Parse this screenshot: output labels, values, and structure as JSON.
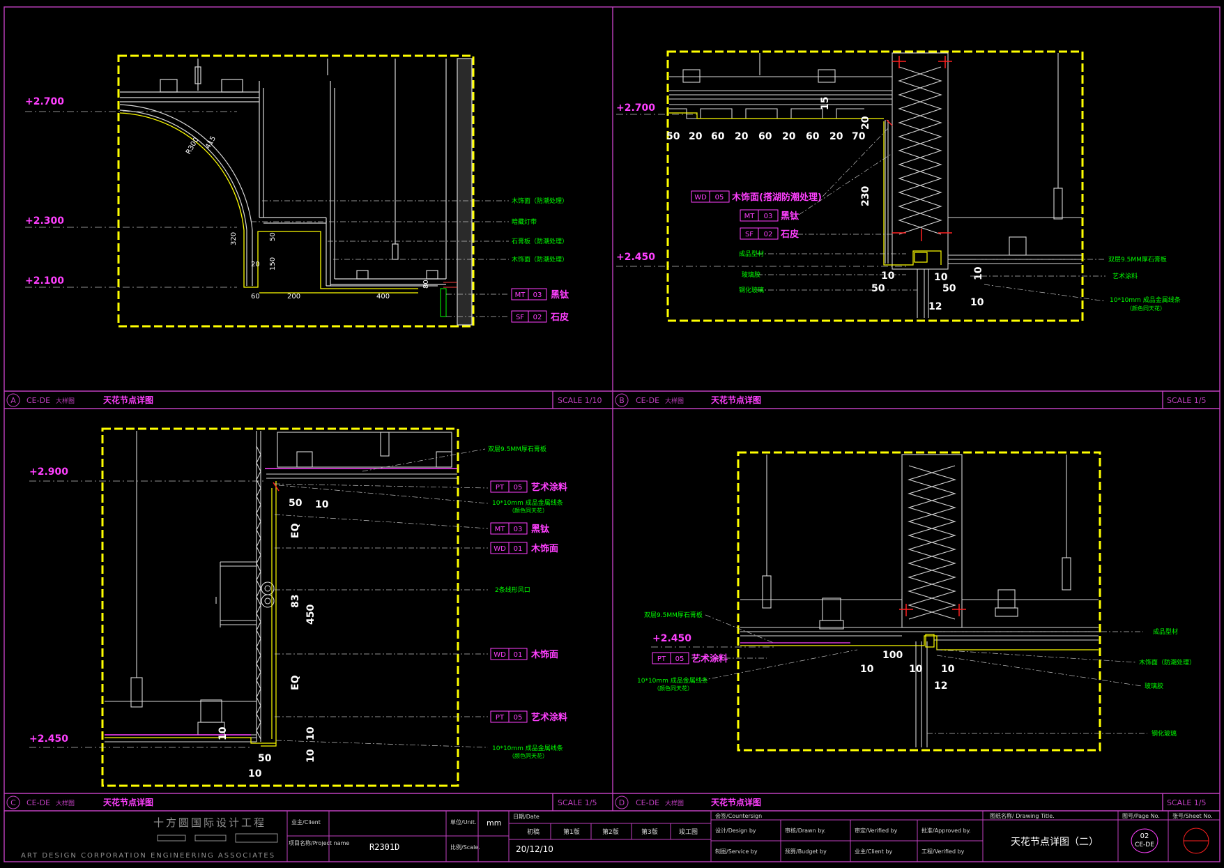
{
  "colors": {
    "bg": "#000000",
    "frame": "#c040c0",
    "detail": "#ffff00",
    "level": "#ff40ff",
    "note": "#00ff00",
    "line": "#d8d8d8",
    "dim": "#ffffff",
    "tag": "#ff40ff",
    "accent": "#ff2020"
  },
  "panels": {
    "a": {
      "letter": "A",
      "code": "CE-DE",
      "kind": "大样图",
      "title": "天花节点详图",
      "scale": "SCALE 1/10",
      "levels": [
        "+2.700",
        "+2.300",
        "+2.100"
      ],
      "dims": [
        "R300",
        "415",
        "320",
        "20",
        "150",
        "50",
        "60",
        "200",
        "400",
        "80"
      ],
      "notes": [
        "木饰面（防潮处理）",
        "暗藏灯带",
        "石膏板（防潮处理）",
        "木饰面（防潮处理）"
      ],
      "tags": [
        {
          "code": "MT",
          "num": "03",
          "label": "黑钛"
        },
        {
          "code": "SF",
          "num": "02",
          "label": "石皮"
        }
      ]
    },
    "b": {
      "letter": "B",
      "code": "CE-DE",
      "kind": "大样图",
      "title": "天花节点详图",
      "scale": "SCALE 1/5",
      "levels": [
        "+2.700",
        "+2.450"
      ],
      "dims": [
        "50",
        "20",
        "60",
        "20",
        "60",
        "20",
        "60",
        "20",
        "70",
        "15",
        "20",
        "230",
        "10",
        "10",
        "50",
        "50",
        "12",
        "10",
        "10"
      ],
      "tags": [
        {
          "code": "WD",
          "num": "05",
          "label": "木饰面(搭湖防潮处理)"
        },
        {
          "code": "MT",
          "num": "03",
          "label": "黑钛"
        },
        {
          "code": "SF",
          "num": "02",
          "label": "石皮"
        }
      ],
      "notes_left": [
        "成品型材",
        "玻璃胶",
        "钢化玻璃"
      ],
      "notes_right": [
        "双层9.5MM厚石膏板",
        "艺术涂料",
        "10*10mm 成品金属线条",
        "（颜色同天花）"
      ]
    },
    "c": {
      "letter": "C",
      "code": "CE-DE",
      "kind": "大样图",
      "title": "天花节点详图",
      "scale": "SCALE 1/5",
      "levels": [
        "+2.900",
        "+2.450"
      ],
      "dims": [
        "50",
        "10",
        "EQ",
        "83",
        "450",
        "EQ",
        "10",
        "10",
        "50",
        "10",
        "10"
      ],
      "notes": [
        "双层9.5MM厚石膏板",
        "10*10mm 成品金属线条",
        "（颜色同天花）",
        "2条线形风口",
        "10*10mm 成品金属线条",
        "（颜色同天花）"
      ],
      "tags": [
        {
          "code": "PT",
          "num": "05",
          "label": "艺术涂料"
        },
        {
          "code": "MT",
          "num": "03",
          "label": "黑钛"
        },
        {
          "code": "WD",
          "num": "01",
          "label": "木饰面"
        },
        {
          "code": "WD",
          "num": "01",
          "label": "木饰面"
        },
        {
          "code": "PT",
          "num": "05",
          "label": "艺术涂料"
        }
      ]
    },
    "d": {
      "letter": "D",
      "code": "CE-DE",
      "kind": "大样图",
      "title": "天花节点详图",
      "scale": "SCALE 1/5",
      "levels": [
        "+2.450"
      ],
      "dims": [
        "100",
        "10",
        "10",
        "10",
        "12"
      ],
      "tag": {
        "code": "PT",
        "num": "05",
        "label": "艺术涂料"
      },
      "notes_left": [
        "双层9.5MM厚石膏板",
        "10*10mm 成品金属线条",
        "（颜色同天花）"
      ],
      "notes_right": [
        "成品型材",
        "木饰面（防潮处理）",
        "玻璃胶",
        "钢化玻璃"
      ]
    }
  },
  "title_block": {
    "firm_cn": "十方圆国际设计工程",
    "firm_en": "ART DESIGN CORPORATION ENGINEERING ASSOCIATES",
    "client_label": "业主/Client",
    "project_label": "项目名称/Project name",
    "project_value": "R2301D",
    "unit_label": "单位/Unit.",
    "unit_value": "mm",
    "scale_label": "比例/Scale.",
    "date_label": "日期/Date",
    "date_value": "20/12/10",
    "stages": [
      "初稿",
      "第1版",
      "第2版",
      "第3版",
      "竣工图"
    ],
    "countersign": "会签/Countersign",
    "roles": [
      [
        "设计/Design by",
        "审核/Drawn by.",
        "审定/Verified by",
        "批准/Approved by."
      ],
      [
        "制图/Service by",
        "预算/Budget by",
        "业主/Client by",
        "工程/Verified by"
      ]
    ],
    "drawing_title_label": "图纸名称/ Drawing Title.",
    "drawing_title": "天花节点详图（二）",
    "page_label": "图号/Page No.",
    "page_value": "02",
    "page_sub": "CE-DE",
    "sheet_label": "张号/Sheet No."
  }
}
